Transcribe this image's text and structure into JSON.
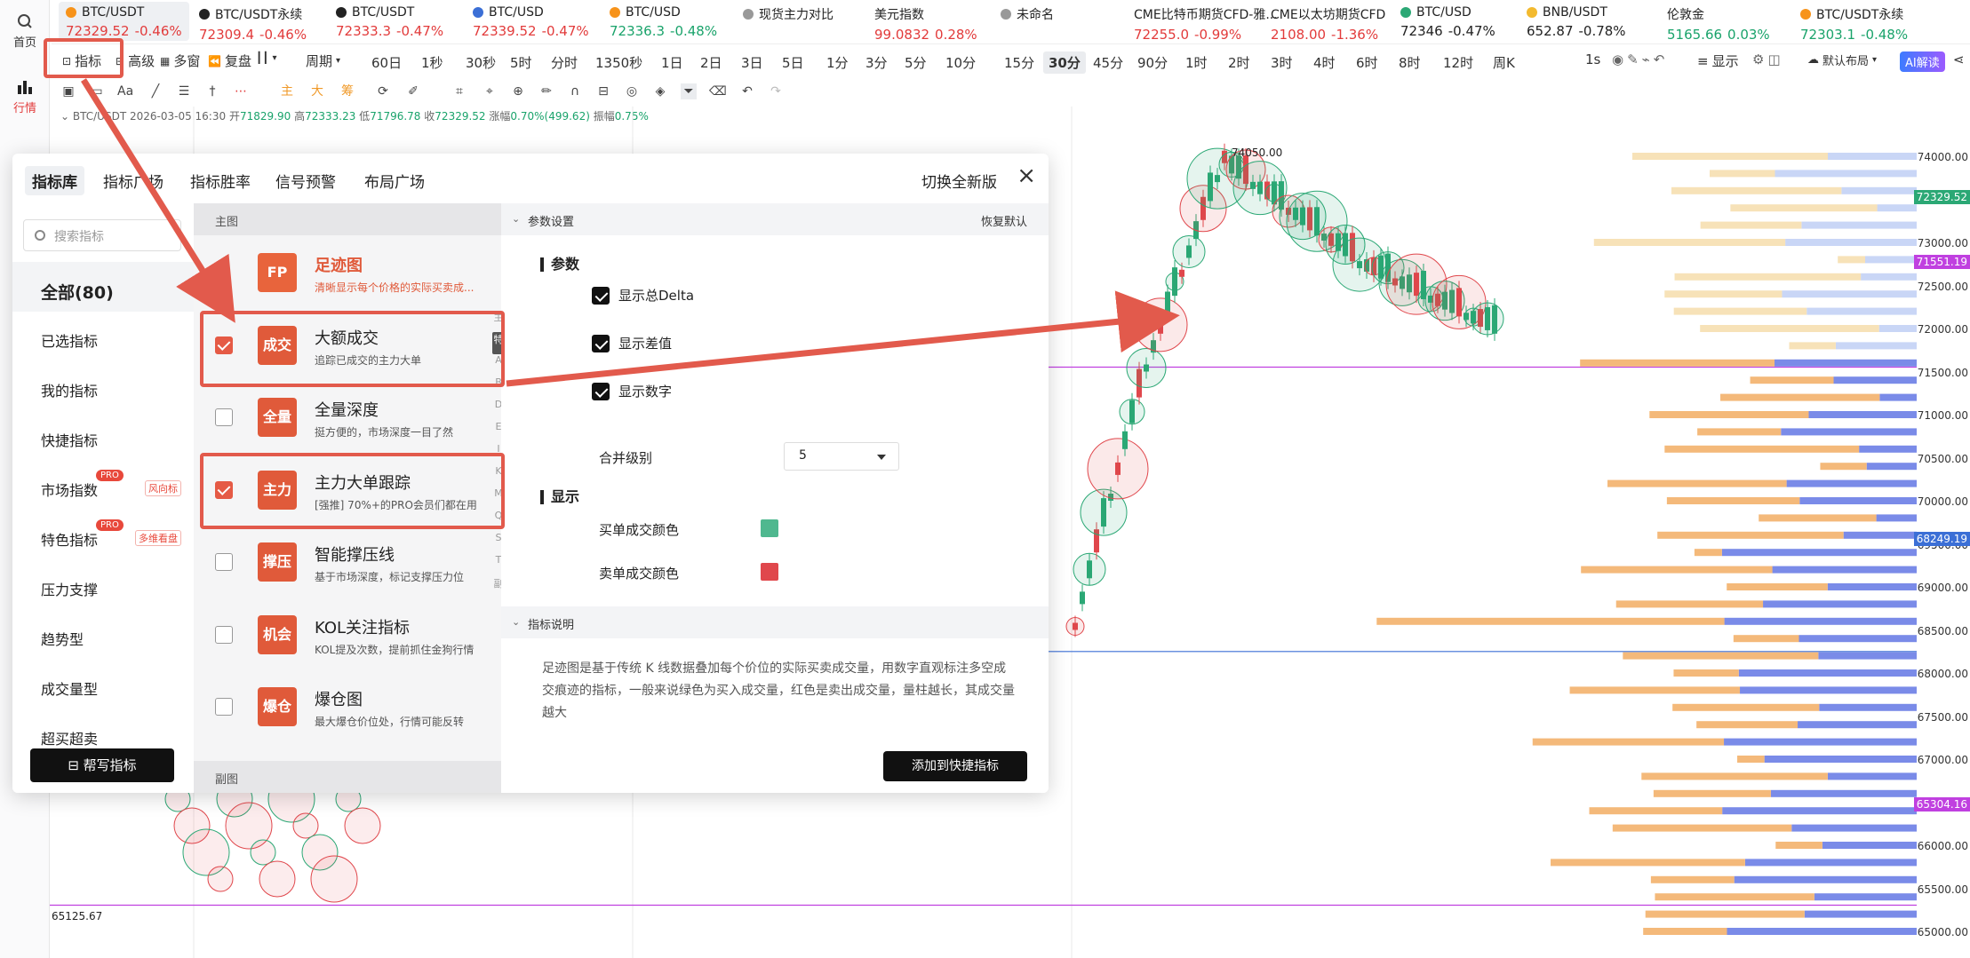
{
  "rail": {
    "home": "首页",
    "market": "行情"
  },
  "tickers": [
    {
      "name": "BTC/USDT",
      "price": "72329.52",
      "chg": "-0.46%",
      "color": "red",
      "icon": "btc-icon"
    },
    {
      "name": "BTC/USDT永续",
      "price": "72309.4",
      "chg": "-0.46%",
      "color": "red",
      "icon": "okx-icon"
    },
    {
      "name": "BTC/USDT",
      "price": "72333.3",
      "chg": "-0.47%",
      "color": "red",
      "icon": "okx-icon"
    },
    {
      "name": "BTC/USD",
      "price": "72339.52",
      "chg": "-0.47%",
      "color": "red",
      "icon": "coinbase-icon"
    },
    {
      "name": "BTC/USD",
      "price": "72336.3",
      "chg": "-0.48%",
      "color": "green",
      "icon": "btc-icon"
    },
    {
      "name": "现货主力对比",
      "price": "",
      "chg": "",
      "color": "",
      "icon": "grid-icon"
    },
    {
      "name": "美元指数",
      "price": "99.0832",
      "chg": "0.28%",
      "color": "red",
      "icon": ""
    },
    {
      "name": "未命名",
      "price": "",
      "chg": "",
      "color": "",
      "icon": "layout-icon"
    },
    {
      "name": "CME比特币期货CFD-雅...",
      "price": "72255.0",
      "chg": "-0.99%",
      "color": "red",
      "icon": ""
    },
    {
      "name": "CME以太坊期货CFD",
      "price": "2108.00",
      "chg": "-1.36%",
      "color": "red",
      "icon": ""
    },
    {
      "name": "BTC/USD",
      "price": "72346",
      "chg": "-0.47%",
      "color": "",
      "icon": "usd-icon"
    },
    {
      "name": "BNB/USDT",
      "price": "652.87",
      "chg": "-0.78%",
      "color": "",
      "icon": "bnb-icon"
    },
    {
      "name": "伦敦金",
      "price": "5165.66",
      "chg": "0.03%",
      "color": "green",
      "icon": ""
    },
    {
      "name": "BTC/USDT永续",
      "price": "72303.1",
      "chg": "-0.48%",
      "color": "green",
      "icon": "btc-icon"
    }
  ],
  "toolbar": {
    "indicator": "指标",
    "advanced": "高级",
    "multiwin": "多窗",
    "replay": "复盘",
    "period": "周期",
    "timeframes": [
      "60日",
      "1秒",
      "30秒",
      "5时",
      "分时",
      "1350秒",
      "1日",
      "2日",
      "3日",
      "5日",
      "1分",
      "3分",
      "5分",
      "10分",
      "15分",
      "30分",
      "45分",
      "90分",
      "1时",
      "2时",
      "3时",
      "4时",
      "6时",
      "8时",
      "12时",
      "周K"
    ],
    "selected_tf": "30分",
    "one_s": "1s",
    "display": "显示",
    "layout": "默认布局",
    "ai": "AI解读"
  },
  "drawtools": {
    "chars": [
      "主",
      "大",
      "筹"
    ]
  },
  "ohlc": {
    "symbol": "BTC/USDT",
    "time": "2026-03-05 16:30",
    "open_label": "开",
    "open": "71829.90",
    "high_label": "高",
    "high": "72333.23",
    "low_label": "低",
    "low": "71796.78",
    "close_label": "收",
    "close": "72329.52",
    "chg_label": "涨幅",
    "chg": "0.70%(499.62)",
    "amp_label": "振幅",
    "amp": "0.75%"
  },
  "axis": {
    "labels": [
      "74000.00",
      "73500.00",
      "73000.00",
      "72500.00",
      "72000.00",
      "71500.00",
      "71000.00",
      "70500.00",
      "70000.00",
      "69500.00",
      "69000.00",
      "68500.00",
      "68000.00",
      "67500.00",
      "67000.00",
      "66500.00",
      "66000.00",
      "65500.00",
      "65000.00"
    ],
    "tags": [
      {
        "v": "72329.52",
        "c": "#2ba875"
      },
      {
        "v": "71551.19",
        "c": "#c040e0"
      },
      {
        "v": "68249.19",
        "c": "#3b6fd6"
      },
      {
        "v": "65304.16",
        "c": "#c040e0"
      }
    ],
    "peak_label": "74050.00",
    "low_label": "65125.67"
  },
  "modal": {
    "tabs": [
      "指标库",
      "指标广场",
      "指标胜率",
      "信号预警",
      "布局广场"
    ],
    "switch_new": "切换全新版",
    "close": "×",
    "search_placeholder": "搜索指标",
    "categories": [
      {
        "label": "全部(80)"
      },
      {
        "label": "已选指标"
      },
      {
        "label": "我的指标"
      },
      {
        "label": "快捷指标"
      },
      {
        "label": "市场指数",
        "pro": "PRO",
        "tag": "风向标"
      },
      {
        "label": "特色指标",
        "pro": "PRO",
        "tag": "多维看盘"
      },
      {
        "label": "压力支撑"
      },
      {
        "label": "趋势型"
      },
      {
        "label": "成交量型"
      },
      {
        "label": "超买超卖"
      }
    ],
    "help_btn": "帮写指标",
    "list_head": "主图",
    "list_foot": "副图",
    "rows": [
      {
        "badge": "FP",
        "title": "足迹图",
        "desc": "清晰显示每个价格的实际买卖成...",
        "checked": false,
        "badge_color": "#e8643c"
      },
      {
        "badge": "成交",
        "title": "大额成交",
        "desc": "追踪已成交的主力大单",
        "checked": true,
        "badge_color": "#e05a3a"
      },
      {
        "badge": "全量",
        "title": "全量深度",
        "desc": "挺方便的，市场深度一目了然",
        "checked": false,
        "badge_color": "#e05a3a"
      },
      {
        "badge": "主力",
        "title": "主力大单跟踪",
        "desc": "[强推] 70%+的PRO会员们都在用",
        "checked": true,
        "badge_color": "#e05a3a"
      },
      {
        "badge": "撑压",
        "title": "智能撑压线",
        "desc": "基于市场深度，标记支撑压力位",
        "checked": false,
        "badge_color": "#e05a3a"
      },
      {
        "badge": "机会",
        "title": "KOL关注指标",
        "desc": "KOL提及次数，提前抓住金狗行情",
        "checked": false,
        "badge_color": "#e05a3a"
      },
      {
        "badge": "爆仓",
        "title": "爆仓图",
        "desc": "最大爆仓价位处，行情可能反转",
        "checked": false,
        "badge_color": "#e05a3a"
      }
    ],
    "alpha": [
      "主",
      "特",
      "A",
      "B",
      "D",
      "E",
      "I",
      "K",
      "M",
      "Q",
      "S",
      "T",
      "副"
    ],
    "params_head": "参数设置",
    "reset": "恢复默认",
    "params_sub": "参数",
    "opt1": "显示总Delta",
    "opt2": "显示差值",
    "opt3": "显示数字",
    "merge_label": "合并级别",
    "merge_value": "5",
    "display_sub": "显示",
    "buy_color_label": "买单成交颜色",
    "sell_color_label": "卖单成交颜色",
    "buy_color": "#4fb88f",
    "sell_color": "#e0474c",
    "desc_head": "指标说明",
    "desc": "足迹图是基于传统 K 线数据叠加每个价位的实际买卖成交量，用数字直观标注多空成交痕迹的指标，一般来说绿色为买入成交量，红色是卖出成交量，量柱越长，其成交量越大",
    "add_btn": "添加到快捷指标"
  }
}
